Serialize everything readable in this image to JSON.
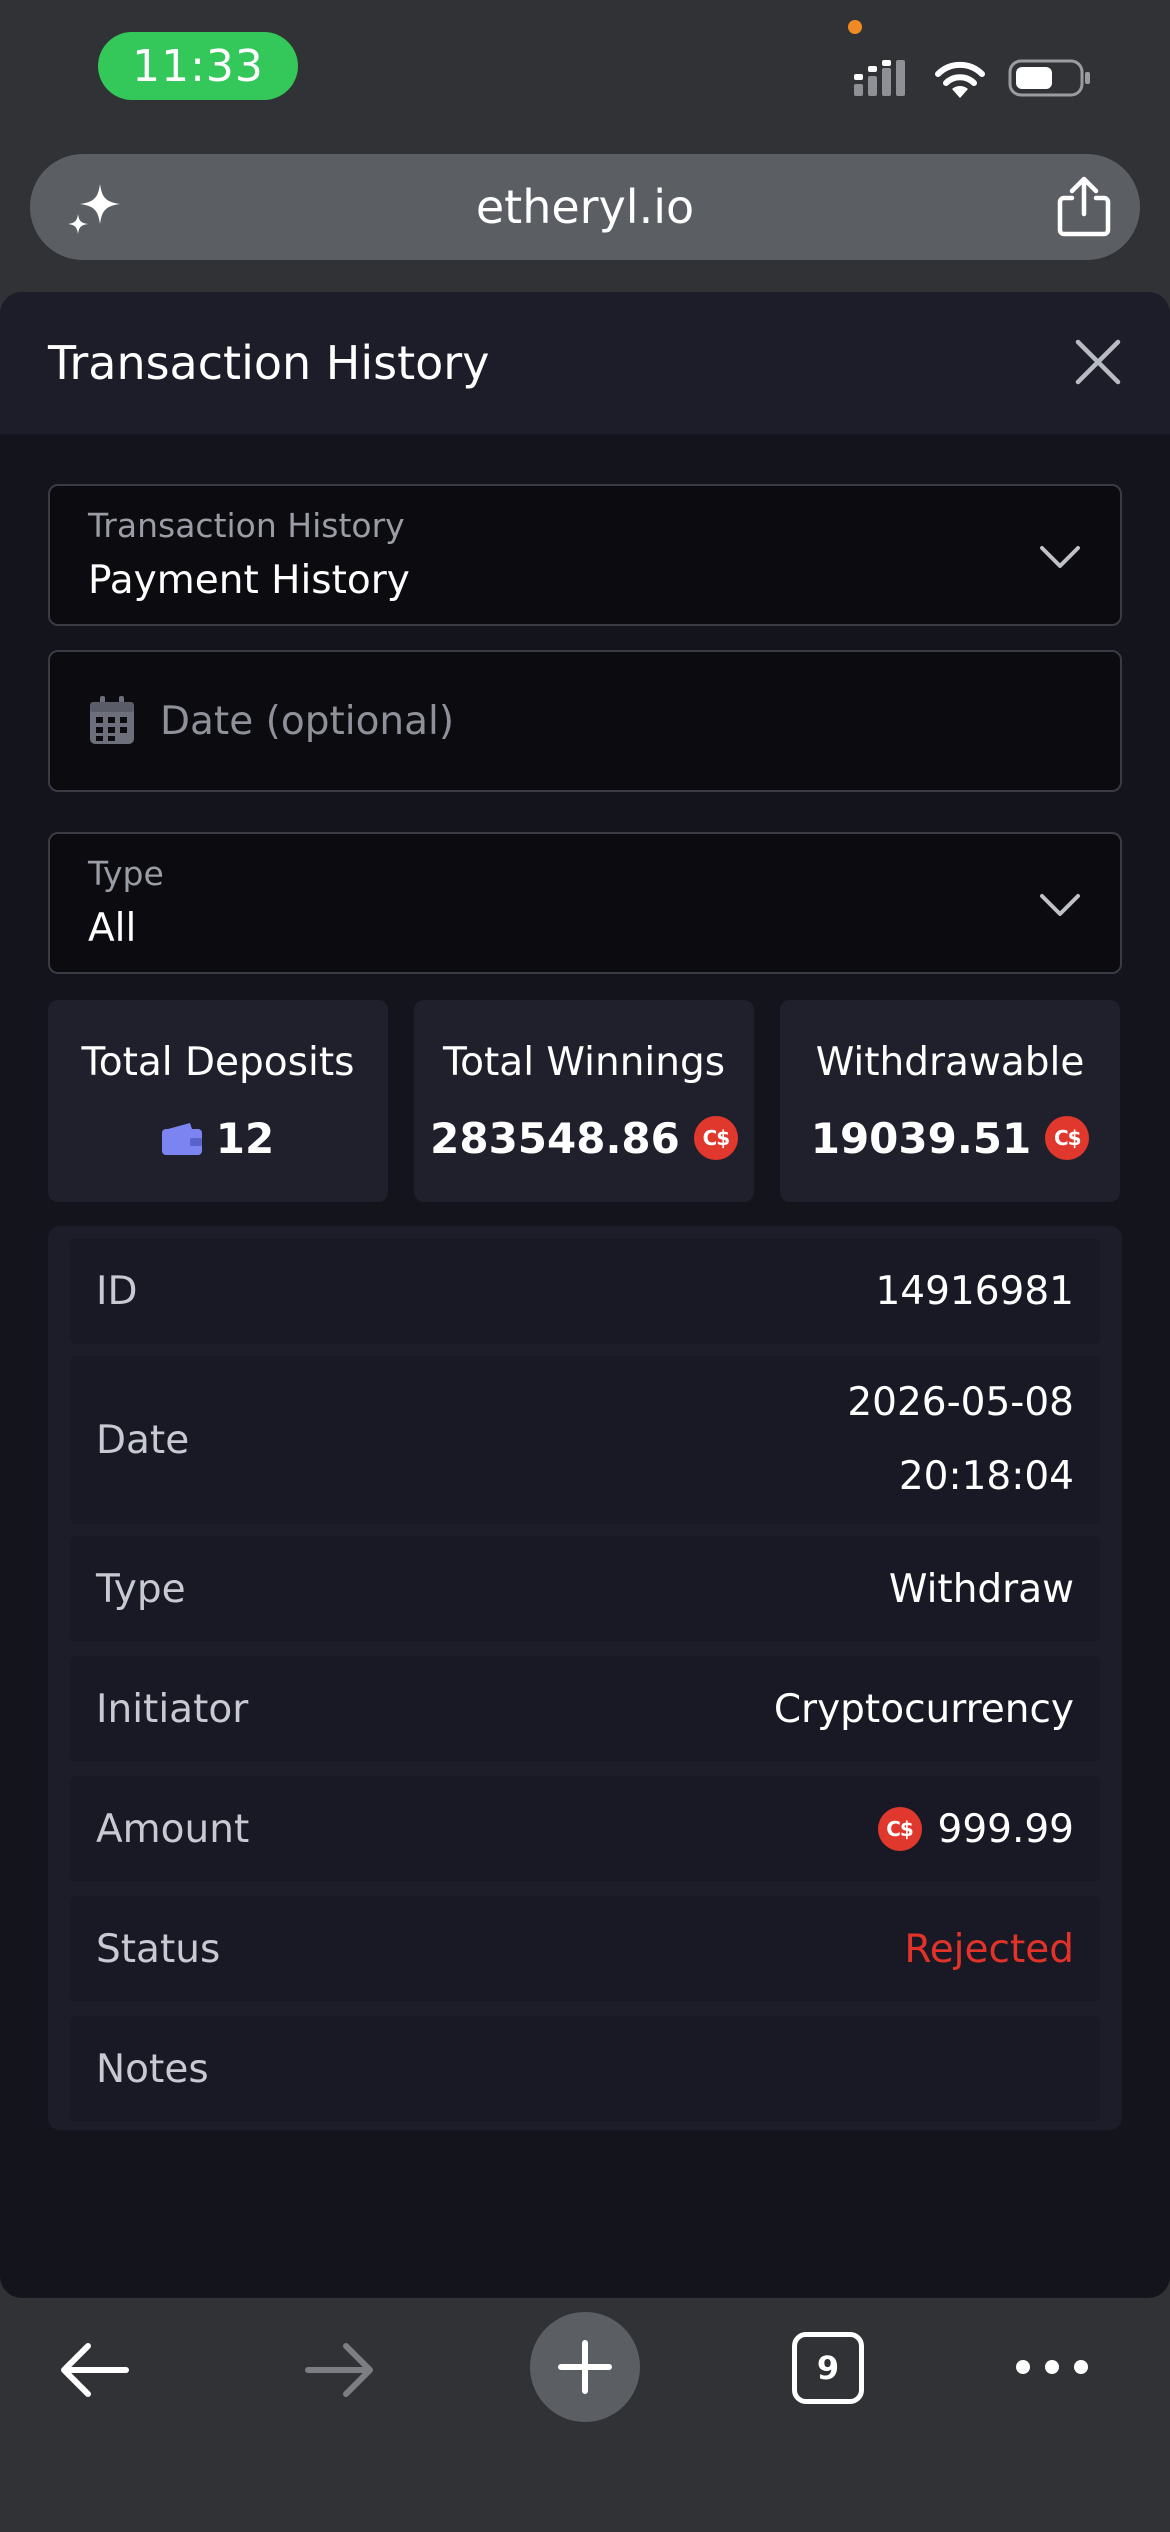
{
  "status_bar": {
    "time": "11:33",
    "icons": [
      "signal-icon",
      "wifi-icon",
      "battery-icon"
    ]
  },
  "browser": {
    "url": "etheryl.io",
    "icons": [
      "sparkle-icon",
      "share-icon"
    ]
  },
  "modal": {
    "title": "Transaction History",
    "close_icon": "close-icon"
  },
  "filters": {
    "history_select": {
      "label": "Transaction History",
      "value": "Payment History"
    },
    "date_input": {
      "placeholder": "Date (optional)"
    },
    "type_select": {
      "label": "Type",
      "value": "All"
    }
  },
  "stats": [
    {
      "label": "Total Deposits",
      "value": "12",
      "icon": "wallet-icon"
    },
    {
      "label": "Total Winnings",
      "value": "283548.86",
      "currency": "C$"
    },
    {
      "label": "Withdrawable",
      "value": "19039.51",
      "currency": "C$"
    }
  ],
  "transaction": {
    "id": {
      "label": "ID",
      "value": "14916981"
    },
    "date": {
      "label": "Date",
      "date": "2026-05-08",
      "time": "20:18:04"
    },
    "type": {
      "label": "Type",
      "value": "Withdraw"
    },
    "initiator": {
      "label": "Initiator",
      "value": "Cryptocurrency"
    },
    "amount": {
      "label": "Amount",
      "value": "999.99",
      "currency": "C$"
    },
    "status": {
      "label": "Status",
      "value": "Rejected"
    },
    "notes": {
      "label": "Notes",
      "value": ""
    }
  },
  "toolbar": {
    "tab_count": "9",
    "icons": [
      "back-arrow-icon",
      "forward-arrow-icon",
      "new-tab-icon",
      "tabs-icon",
      "more-icon"
    ]
  },
  "colors": {
    "panel_bg": "#13141c",
    "card_bg": "#1f202c",
    "accent_green": "#34c759",
    "currency_red": "#e0382c",
    "status_rejected": "#e2332a",
    "wallet_blue": "#7b84f0"
  }
}
